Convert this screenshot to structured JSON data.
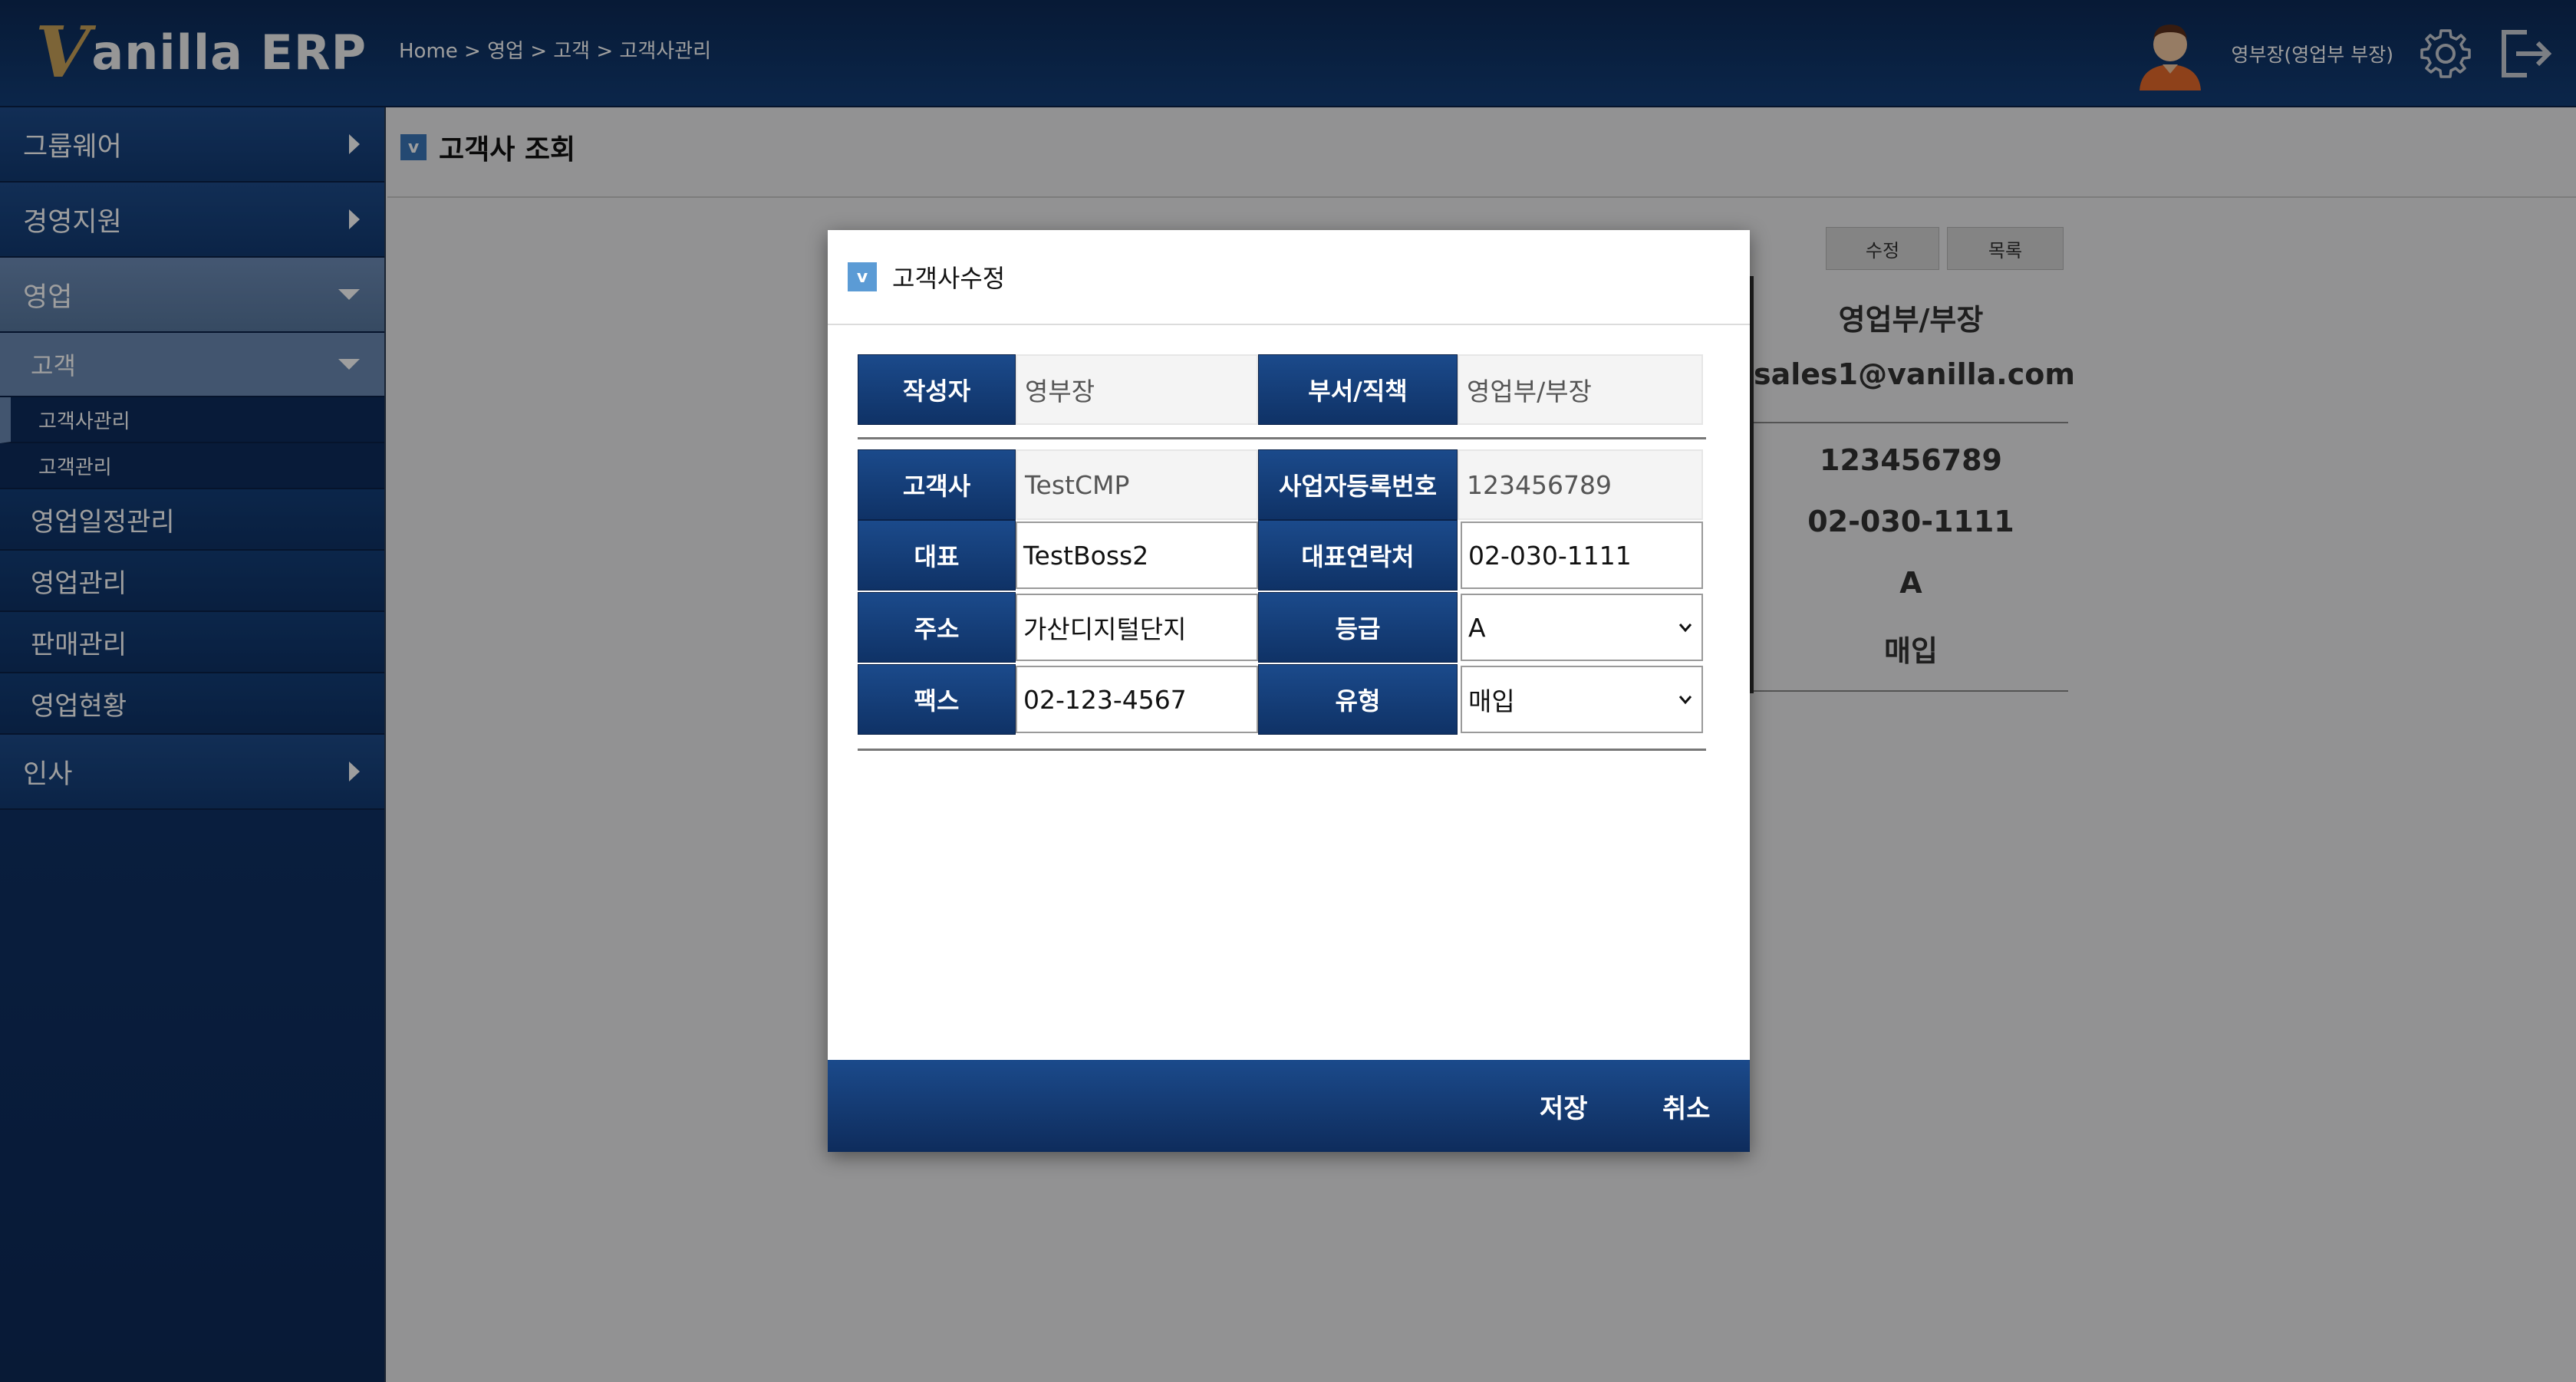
{
  "header": {
    "logo_v": "V",
    "logo_rest": "anilla ERP",
    "breadcrumb": "Home > 영업 > 고객 > 고객사관리",
    "user_name": "영부장(영업부 부장)",
    "icons": [
      "avatar",
      "gear-icon",
      "logout-icon"
    ]
  },
  "sidebar": {
    "groupware": "그룹웨어",
    "management": "경영지원",
    "sales": "영업",
    "customer": "고객",
    "customer_company_mgmt": "고객사관리",
    "customer_mgmt": "고객관리",
    "sales_schedule": "영업일정관리",
    "sales_mgmt": "영업관리",
    "sales_sell_mgmt": "판매관리",
    "sales_status": "영업현황",
    "hr": "인사"
  },
  "page": {
    "title": "고객사 조회",
    "edit_button": "수정",
    "list_button": "목록",
    "detail": {
      "dept_position": "영업부/부장",
      "email": "sales1@vanilla.com",
      "biz_number": "123456789",
      "phone": "02-030-1111",
      "grade": "A",
      "type": "매입"
    }
  },
  "modal": {
    "badge": "v",
    "title": "고객사수정",
    "labels": {
      "writer": "작성자",
      "dept_position": "부서/직책",
      "company": "고객사",
      "biz_number": "사업자등록번호",
      "ceo": "대표",
      "ceo_phone": "대표연락처",
      "address": "주소",
      "grade": "등급",
      "fax": "팩스",
      "type": "유형"
    },
    "values": {
      "writer": "영부장",
      "dept_position": "영업부/부장",
      "company": "TestCMP",
      "biz_number": "123456789",
      "ceo": "TestBoss2",
      "ceo_phone": "02-030-1111",
      "address": "가산디지털단지",
      "grade": "A",
      "fax": "02-123-4567",
      "type": "매입"
    },
    "save_button": "저장",
    "cancel_button": "취소"
  },
  "colors": {
    "header_bg": "#0c2a57",
    "sidebar_bg": "#143a73",
    "active_menu": "#6b8ab3",
    "label_bg": "#1b4a8b",
    "logo_gold": "#c9a25a"
  }
}
